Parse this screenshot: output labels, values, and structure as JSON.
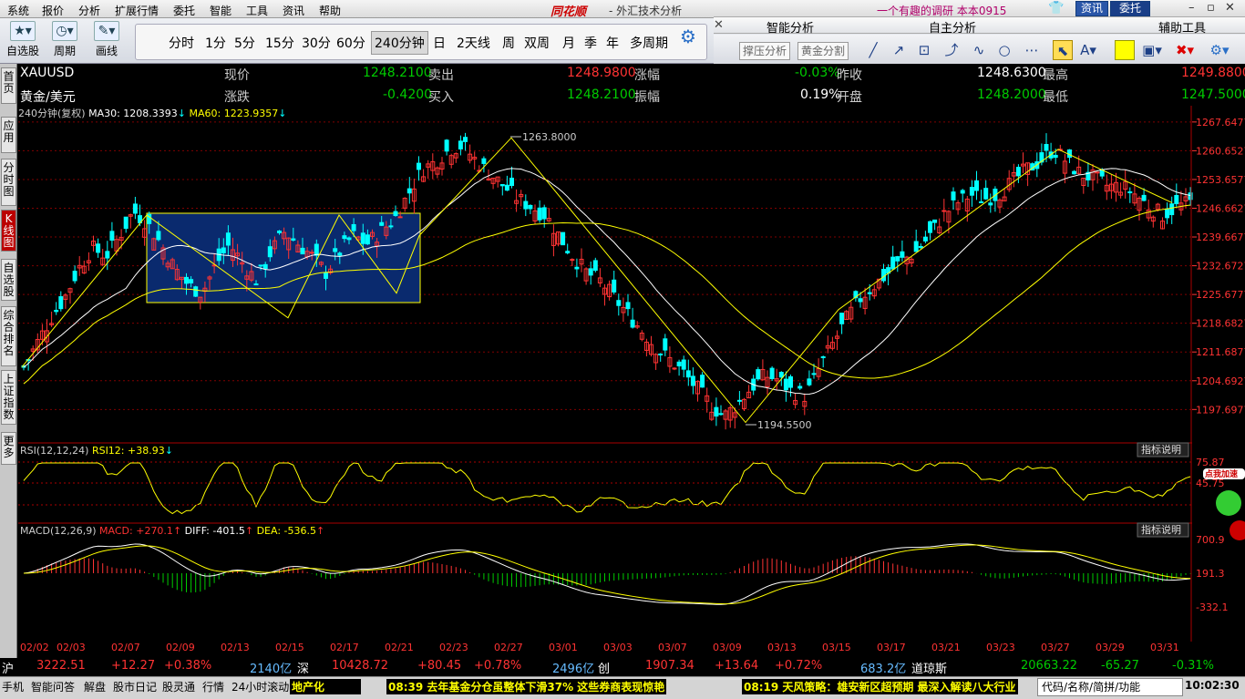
{
  "menubar": {
    "items": [
      "系统",
      "报价",
      "分析",
      "扩展行情",
      "委托",
      "智能",
      "工具",
      "资讯",
      "帮助"
    ],
    "brand": "同花顺",
    "brand_sub": "- 外汇技术分析",
    "account": "一个有趣的调研  本本0915",
    "btn_news": "资讯",
    "btn_trade": "委托"
  },
  "toolbar": {
    "tools": [
      {
        "label": "自选股",
        "icon": "star-icon"
      },
      {
        "label": "周期",
        "icon": "clock-icon"
      },
      {
        "label": "画线",
        "icon": "pencil-icon"
      }
    ],
    "periods": [
      "分时",
      "1分",
      "5分",
      "15分",
      "30分",
      "60分",
      "240分钟",
      "日",
      "2天线",
      "周",
      "双周",
      "月",
      "季",
      "年",
      "多周期"
    ],
    "active_period": "240分钟"
  },
  "panels": {
    "smart": "智能分析",
    "custom": "自主分析",
    "assist": "辅助工具",
    "btn_pressure": "撑压分析",
    "btn_golden": "黄金分割"
  },
  "sidebar": [
    "首页",
    "应用",
    "分时图",
    "K线图",
    "自选股",
    "综合排名",
    "上证指数",
    "更多"
  ],
  "quote": {
    "symbol": "XAUUSD",
    "name": "黄金/美元",
    "now_label": "现价",
    "now": "1248.2100",
    "chg_label": "涨跌",
    "chg": "-0.4200",
    "sell_label": "卖出",
    "sell": "1248.9800",
    "buy_label": "买入",
    "buy": "1248.2100",
    "pct_label": "涨幅",
    "pct": "-0.03%",
    "amp_label": "振幅",
    "amp": "0.19%",
    "prev_label": "昨收",
    "prev": "1248.6300",
    "open_label": "开盘",
    "open": "1248.2000",
    "high_label": "最高",
    "high": "1249.8800",
    "low_label": "最低",
    "low": "1247.5000"
  },
  "indicators": {
    "main": "240分钟(复权)",
    "ma30": "MA30: 1208.3393",
    "ma60": "MA60: 1223.9357",
    "rsi_label": "RSI(12,12,24)",
    "rsi_val": "RSI12: +38.93",
    "macd_label": "MACD(12,26,9)",
    "macd_val": "MACD: +270.1",
    "diff_val": "DIFF: -401.5",
    "dea_val": "DEA: -536.5",
    "help": "指标说明",
    "promo": "点我加速"
  },
  "chart_data": {
    "type": "candlestick",
    "y_axis_ticks": [
      "1267.6477",
      "1260.6527",
      "1253.6577",
      "1246.6627",
      "1239.6677",
      "1232.6727",
      "1225.6777",
      "1218.6827",
      "1211.6877",
      "1204.6927",
      "1197.6977"
    ],
    "ylim": [
      1194.0,
      1268.5
    ],
    "rsi_ticks": [
      "75.87",
      "45.75"
    ],
    "macd_ticks": [
      "700.9",
      "191.3",
      "-332.1"
    ],
    "x_labels": [
      "02/02",
      "02/03",
      "02/07",
      "02/09",
      "02/13",
      "02/15",
      "02/17",
      "02/21",
      "02/23",
      "02/27",
      "03/01",
      "03/03",
      "03/07",
      "03/09",
      "03/13",
      "03/15",
      "03/17",
      "03/21",
      "03/23",
      "03/27",
      "03/29",
      "03/31"
    ],
    "annotations": [
      {
        "text": "1263.8000",
        "type": "high"
      },
      {
        "text": "1194.5500",
        "type": "low"
      }
    ],
    "close_path": [
      1208,
      1214,
      1220,
      1225,
      1232,
      1237,
      1235,
      1240,
      1246,
      1243,
      1238,
      1232,
      1228,
      1226,
      1233,
      1238,
      1233,
      1229,
      1236,
      1241,
      1238,
      1235,
      1231,
      1236,
      1240,
      1238,
      1241,
      1244,
      1250,
      1256,
      1258,
      1261,
      1262,
      1258,
      1255,
      1252,
      1249,
      1247,
      1245,
      1240,
      1235,
      1231,
      1229,
      1225,
      1221,
      1217,
      1213,
      1210,
      1207,
      1203,
      1199,
      1196,
      1199,
      1203,
      1206,
      1205,
      1202,
      1201,
      1208,
      1214,
      1220,
      1225,
      1228,
      1231,
      1234,
      1236,
      1240,
      1245,
      1248,
      1250,
      1249,
      1250,
      1253,
      1256,
      1258,
      1261,
      1258,
      1255,
      1254,
      1252,
      1252,
      1250,
      1247,
      1245,
      1247,
      1248
    ]
  },
  "dates_axis": [
    "02/02",
    "02/03",
    "02/07",
    "02/09",
    "02/13",
    "02/15",
    "02/17",
    "02/21",
    "02/23",
    "02/27",
    "03/01",
    "03/03",
    "03/07",
    "03/09",
    "03/13",
    "03/15",
    "03/17",
    "03/21",
    "03/23",
    "03/27",
    "03/29",
    "03/31"
  ],
  "status1": {
    "sh_label": "沪",
    "sh": "3222.51",
    "sh_chg": "+12.27",
    "sh_pct": "+0.38%",
    "sh_amt": "2140亿",
    "sz_label": "深",
    "sz": "10428.72",
    "sz_chg": "+80.45",
    "sz_pct": "+0.78%",
    "sz_amt": "2496亿",
    "cy_label": "创",
    "cy": "1907.34",
    "cy_chg": "+13.64",
    "cy_pct": "+0.72%",
    "cy_amt": "683.2亿",
    "dj_label": "道琼斯",
    "dj": "20663.22",
    "dj_chg": "-65.27",
    "dj_pct": "-0.31%"
  },
  "status2": {
    "links": [
      "手机",
      "智能问答",
      "解盘",
      "股市日记",
      "股灵通",
      "行情",
      "24小时滚动",
      "地产化"
    ],
    "news1": "08:39 去年基金分仓虽整体下滑37% 这些券商表现惊艳",
    "news2": "08:19 天风策略：雄安新区超预期 最深入解读八大行业",
    "search": "代码/名称/简拼/功能",
    "time": "10:02:30"
  },
  "colors": {
    "up": "#ff3333",
    "down": "#00ffff",
    "ma30": "#ffffff",
    "ma60": "#ffff00",
    "grid": "#800000"
  }
}
